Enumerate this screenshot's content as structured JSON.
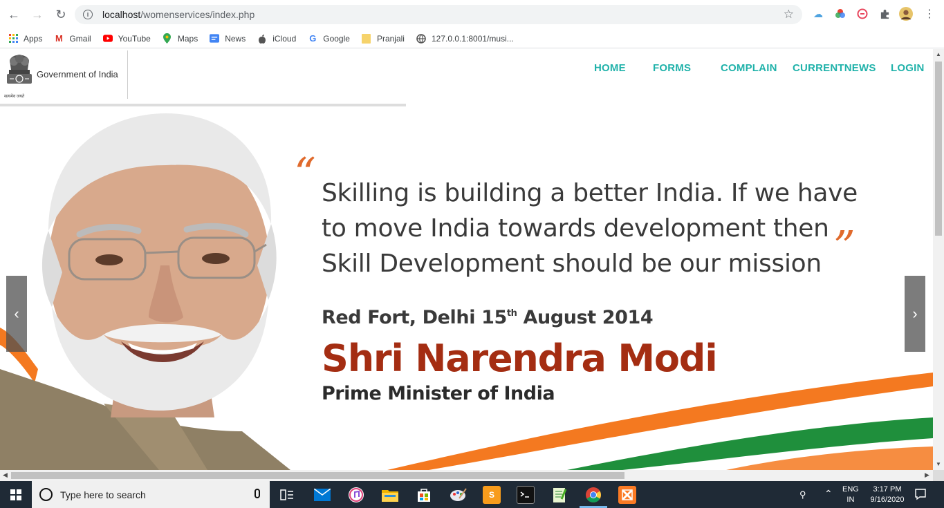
{
  "browser": {
    "url_host": "localhost",
    "url_path": "/womenservices/index.php",
    "bookmarks": [
      {
        "label": "Apps",
        "icon": "apps-grid-icon"
      },
      {
        "label": "Gmail",
        "icon": "gmail-icon"
      },
      {
        "label": "YouTube",
        "icon": "youtube-icon"
      },
      {
        "label": "Maps",
        "icon": "maps-icon"
      },
      {
        "label": "News",
        "icon": "news-icon"
      },
      {
        "label": "iCloud",
        "icon": "apple-icon"
      },
      {
        "label": "Google",
        "icon": "google-icon"
      },
      {
        "label": "Pranjali",
        "icon": "folder-icon"
      },
      {
        "label": "127.0.0.1:8001/musi...",
        "icon": "globe-icon"
      }
    ]
  },
  "site": {
    "org_name": "Government of India",
    "emblem_motto": "सत्यमेव जयते",
    "nav": [
      "HOME",
      "FORMS",
      "COMPLAIN",
      "CURRENTNEWS",
      "LOGIN"
    ],
    "nav_color": "#20b2aa"
  },
  "slide": {
    "open_quote": "“",
    "close_quote": "”",
    "quote_lines": [
      "Skilling is building a better India. If we have",
      "to move India towards development then",
      "Skill Development should be our mission"
    ],
    "place_before": "Red Fort, Delhi 15",
    "place_sup": "th",
    "place_after": " August 2014",
    "name": "Shri Narendra Modi",
    "role": "Prime Minister of India",
    "prev": "‹",
    "next": "›",
    "accent_color": "#e06a2c",
    "name_color": "#a42d12"
  },
  "taskbar": {
    "search_placeholder": "Type here to search",
    "lang_top": "ENG",
    "lang_bottom": "IN",
    "time": "3:17 PM",
    "date": "9/16/2020"
  }
}
